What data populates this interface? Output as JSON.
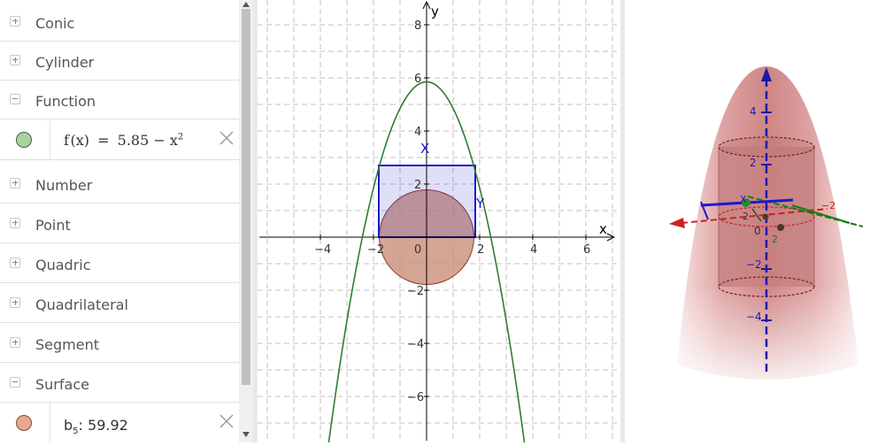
{
  "algebra": {
    "categories": {
      "conic": "Conic",
      "cylinder": "Cylinder",
      "function": "Function",
      "number": "Number",
      "point": "Point",
      "quadric": "Quadric",
      "quadrilateral": "Quadrilateral",
      "segment": "Segment",
      "surface": "Surface"
    },
    "function_item": {
      "name": "f",
      "open": "(",
      "var": "x",
      "close": ")",
      "eq": "=",
      "expr_const": "5.85",
      "minus": "−",
      "expr_var": "x",
      "exponent": "2",
      "color": "#a7d49f"
    },
    "surface_item": {
      "name": "b",
      "subscript": "5",
      "colon": ":",
      "value": "59.92",
      "color": "#e8a890"
    }
  },
  "graphics2d": {
    "axis_x_label": "x",
    "axis_y_label": "y",
    "x_ticks": [
      "−4",
      "−2",
      "0",
      "2",
      "4",
      "6"
    ],
    "y_ticks": [
      "8",
      "6",
      "4",
      "2",
      "−2",
      "−4",
      "−6"
    ],
    "point_x_label": "X",
    "point_y_label": "Y",
    "function_color": "#2e7d32",
    "rect_color": "#1a1acc",
    "circle_color": "#c07050",
    "function": {
      "c": 5.85,
      "form": "c - x^2"
    },
    "rectangle": {
      "x_min": -1.8,
      "x_max": 1.8,
      "y_min": 0,
      "y_max": 2.7
    },
    "circle": {
      "cx": 0,
      "cy": 0,
      "r": 1.75
    }
  },
  "graphics3d": {
    "z_ticks": [
      "4",
      "2",
      "0",
      "−2",
      "−4"
    ],
    "axis_tick_labels": [
      "2",
      "−2",
      "0",
      "2"
    ],
    "point_label": "X"
  }
}
